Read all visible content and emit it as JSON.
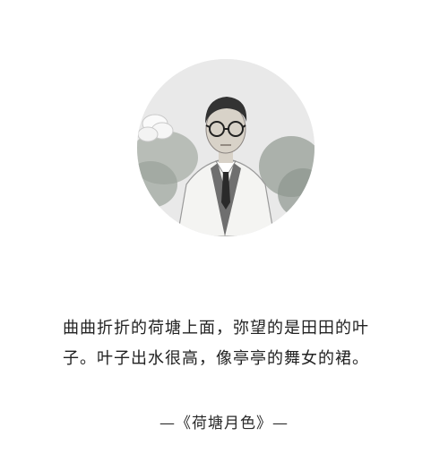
{
  "portrait": {
    "colors": {
      "background": "#e9e9e9",
      "foliage": "#9aa39a",
      "suit": "#f4f4f2",
      "vest": "#6f6f6f",
      "tie": "#2a2a2a",
      "hair": "#333333",
      "skin": "#d8d2c8"
    }
  },
  "quote": {
    "lines": [
      "曲曲折折的荷塘上面，弥望的是田田的叶",
      "子。叶子出水很高，像亭亭的舞女的裙。"
    ]
  },
  "source": {
    "text": "—《荷塘月色》—"
  }
}
